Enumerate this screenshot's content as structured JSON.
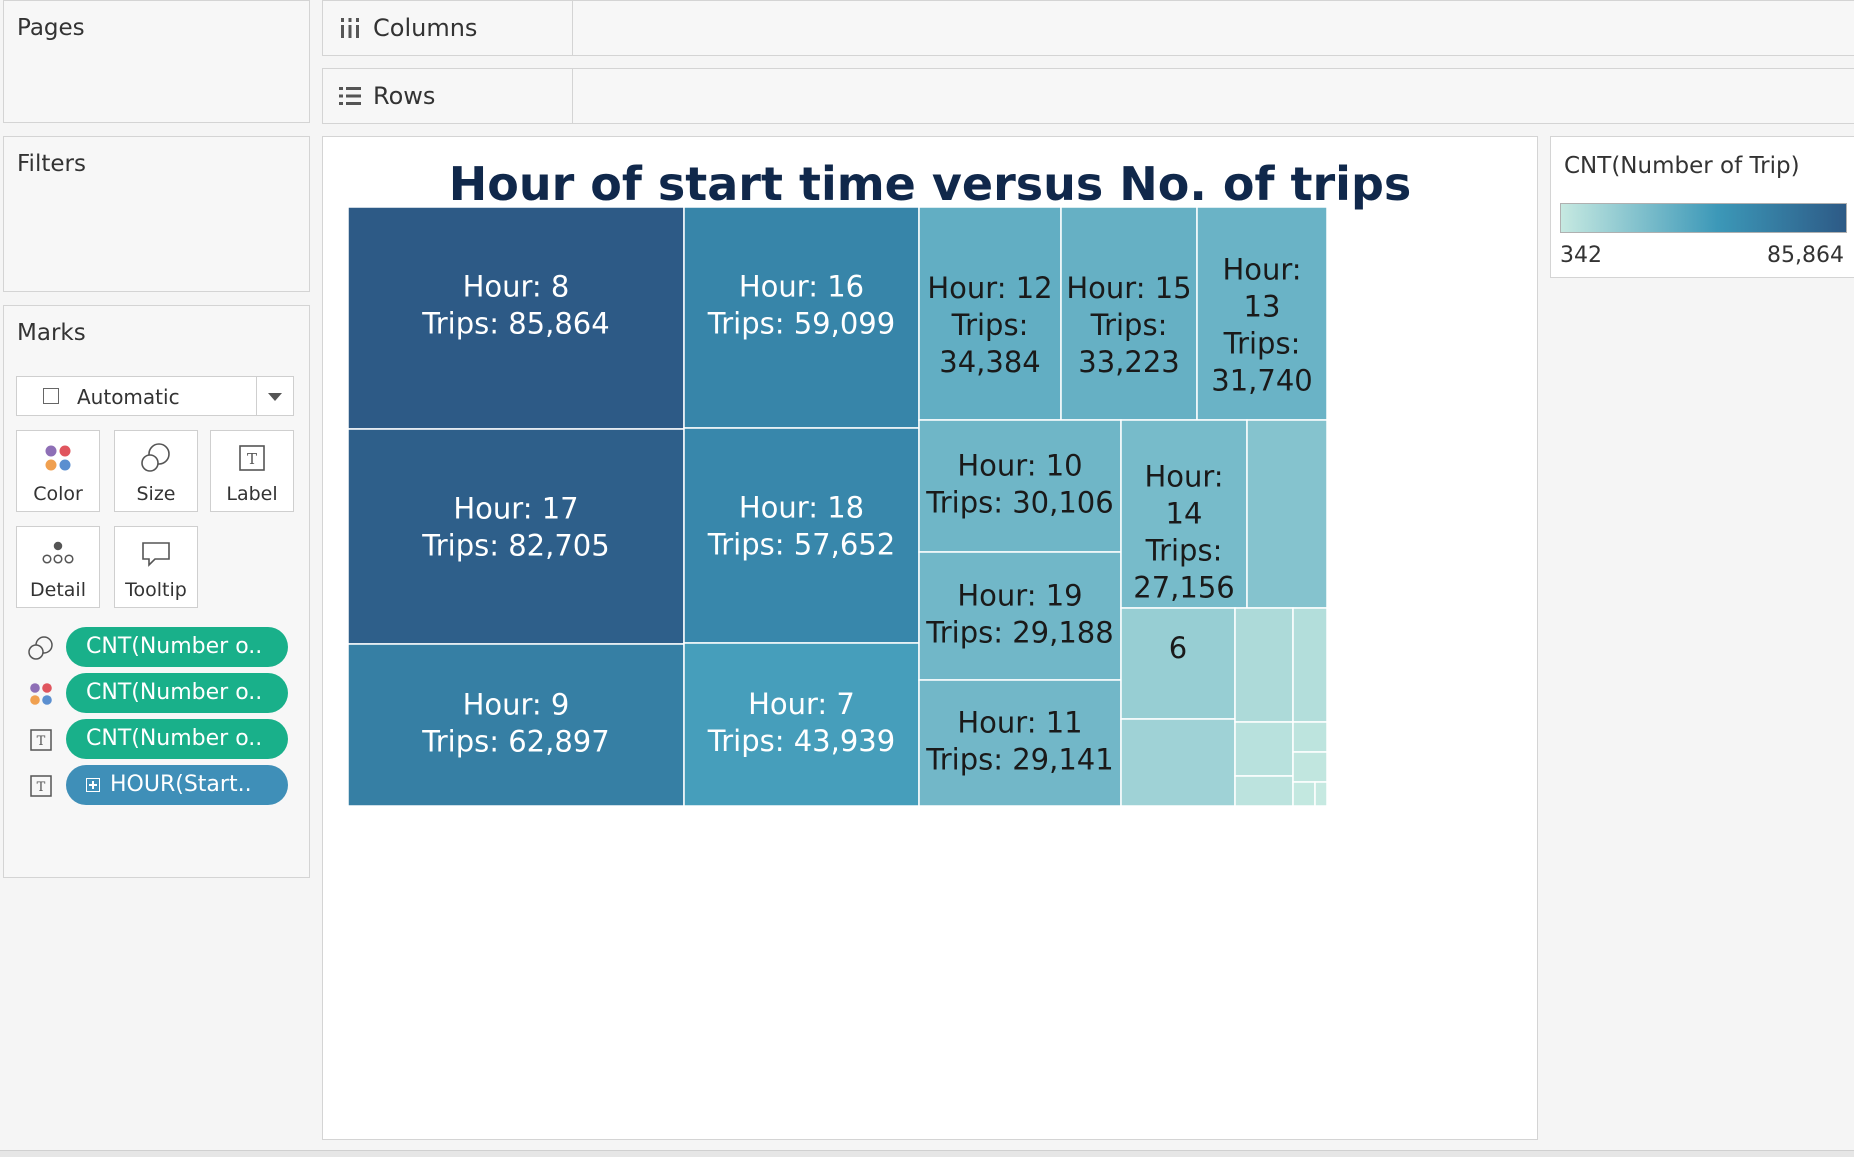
{
  "pages": {
    "label": "Pages"
  },
  "filters": {
    "label": "Filters"
  },
  "columns_shelf": {
    "label": "Columns"
  },
  "rows_shelf": {
    "label": "Rows"
  },
  "marks": {
    "label": "Marks",
    "mark_type": "Automatic",
    "buttons": {
      "color": "Color",
      "size": "Size",
      "label": "Label",
      "detail": "Detail",
      "tooltip": "Tooltip"
    },
    "pills": [
      {
        "icon": "size-icon",
        "text": "CNT(Number o..",
        "color": "#19b08a"
      },
      {
        "icon": "color-icon",
        "text": "CNT(Number o..",
        "color": "#19b08a"
      },
      {
        "icon": "label-icon",
        "text": "CNT(Number o..",
        "color": "#19b08a"
      },
      {
        "icon": "label-icon",
        "text": "HOUR(Start..",
        "color": "#3f8fb8"
      }
    ]
  },
  "legend": {
    "title": "CNT(Number of Trip)",
    "min_label": "342",
    "max_label": "85,864",
    "color_low": "#c6e9e1",
    "color_mid": "#3c98b8",
    "color_high": "#2d5a86"
  },
  "chart_data": {
    "type": "treemap",
    "title": "Hour of start time versus No. of trips",
    "label_format": "Hour: {hour}\nTrips: {trips}",
    "color_min": 342,
    "color_max": 85864,
    "cells": [
      {
        "hour": 8,
        "trips": 85864,
        "lines": [
          "Hour: 8",
          "Trips: 85,864"
        ]
      },
      {
        "hour": 17,
        "trips": 82705,
        "lines": [
          "Hour: 17",
          "Trips: 82,705"
        ]
      },
      {
        "hour": 9,
        "trips": 62897,
        "lines": [
          "Hour: 9",
          "Trips: 62,897"
        ]
      },
      {
        "hour": 16,
        "trips": 59099,
        "lines": [
          "Hour: 16",
          "Trips: 59,099"
        ]
      },
      {
        "hour": 18,
        "trips": 57652,
        "lines": [
          "Hour: 18",
          "Trips: 57,652"
        ]
      },
      {
        "hour": 7,
        "trips": 43939,
        "lines": [
          "Hour: 7",
          "Trips: 43,939"
        ]
      },
      {
        "hour": 12,
        "trips": 34384,
        "lines": [
          "Hour: 12",
          "Trips:",
          "34,384"
        ]
      },
      {
        "hour": 15,
        "trips": 33223,
        "lines": [
          "Hour: 15",
          "Trips:",
          "33,223"
        ]
      },
      {
        "hour": 13,
        "trips": 31740,
        "lines": [
          "Hour:",
          "13",
          "Trips:",
          "31,740"
        ]
      },
      {
        "hour": 10,
        "trips": 30106,
        "lines": [
          "Hour: 10",
          "Trips: 30,106"
        ]
      },
      {
        "hour": 19,
        "trips": 29188,
        "lines": [
          "Hour: 19",
          "Trips: 29,188"
        ]
      },
      {
        "hour": 11,
        "trips": 29141,
        "lines": [
          "Hour: 11",
          "Trips: 29,141"
        ]
      },
      {
        "hour": 14,
        "trips": 27156,
        "lines": [
          "Hour:",
          "14",
          "Trips:",
          "27,156"
        ]
      },
      {
        "hour": null,
        "trips": 22500,
        "lines": []
      },
      {
        "hour": 6,
        "trips": 16200,
        "lines": [
          "6"
        ]
      },
      {
        "hour": null,
        "trips": 13500,
        "lines": []
      },
      {
        "hour": null,
        "trips": 9000,
        "lines": []
      },
      {
        "hour": null,
        "trips": 6800,
        "lines": []
      },
      {
        "hour": null,
        "trips": 5100,
        "lines": []
      },
      {
        "hour": null,
        "trips": 3600,
        "lines": []
      },
      {
        "hour": null,
        "trips": 3300,
        "lines": []
      },
      {
        "hour": null,
        "trips": 2100,
        "lines": []
      },
      {
        "hour": null,
        "trips": 1200,
        "lines": []
      },
      {
        "hour": null,
        "trips": 342,
        "lines": []
      }
    ]
  }
}
